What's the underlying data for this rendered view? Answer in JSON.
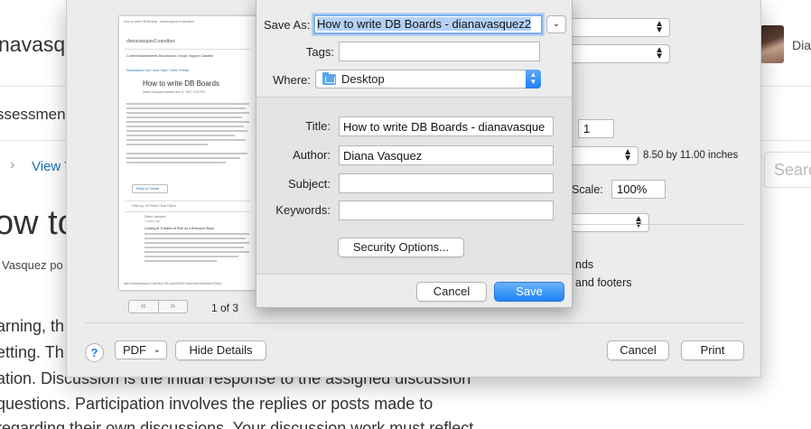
{
  "background_page": {
    "site_title_fragment": "navasqu",
    "user_name_fragment": "Dia",
    "nav_fragment": "ssessmen",
    "breadcrumb_fragment": "View T",
    "search_placeholder_fragment": "Searc",
    "heading_fragment": "ow to",
    "author_fragment": "Vasquez po",
    "paragraph_lines": [
      "arning, th",
      "etting. Th",
      "ation.  Discussion is the initial response to the assigned discussion",
      "questions.  Participation involves the replies or posts made to",
      "regarding their own discussions.  Your discussion work must reflect"
    ]
  },
  "print_dialog": {
    "preview": {
      "header_left": "How to write DB Boards - dianavasquez2.sandbox",
      "site": "dianavasquez2.sandbox",
      "menu": "Content   Assessments   Discussions   Groups   Support   Classlist",
      "crumbs": "Discussions List  /  View Topic  /  View Thread",
      "title": "How to write DB Boards",
      "byline": "Diana Vasquez posted Nov 9, 2017 4:02 PM",
      "reply_button": "Reply to Thread",
      "filter": "Filter by:  All Posts    Clear Filters",
      "reply_author": "Diana Vasquez",
      "reply_meta": "3 hours ago",
      "reply_subject": "Looking at 'A Nation at Risk' as a Research Study",
      "footer": "https://dianavasquez2.sandbox.d2l.com/d2l/le/21/discussions/threads/3/View"
    },
    "pager": {
      "prev": "«",
      "next": "»"
    },
    "page_indicator": "1 of 3",
    "copies_value": "1",
    "paper_size": "8.50 by 11.00 inches",
    "scale_label": "Scale:",
    "scale_value": "100%",
    "options_partial": [
      "nds",
      "and footers"
    ],
    "help_label": "?",
    "pdf_label": "PDF",
    "hide_details_label": "Hide Details",
    "cancel_label": "Cancel",
    "print_label": "Print"
  },
  "save_sheet": {
    "save_as_label": "Save As:",
    "save_as_value": "How to write DB Boards - dianavasquez2",
    "tags_label": "Tags:",
    "tags_value": "",
    "where_label": "Where:",
    "where_value": "Desktop",
    "title_label": "Title:",
    "title_value": "How to write DB Boards - dianavasque",
    "author_label": "Author:",
    "author_value": "Diana Vasquez",
    "subject_label": "Subject:",
    "subject_value": "",
    "keywords_label": "Keywords:",
    "keywords_value": "",
    "security_button": "Security Options...",
    "cancel_label": "Cancel",
    "save_label": "Save"
  }
}
